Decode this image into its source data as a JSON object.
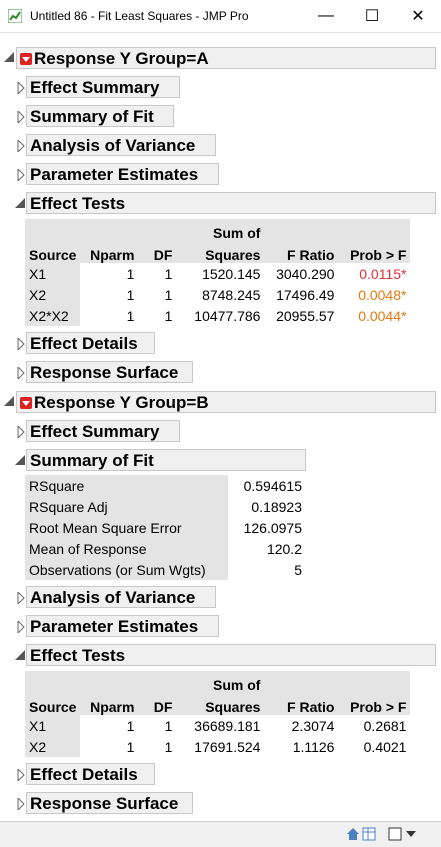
{
  "window": {
    "title": "Untitled 86 - Fit Least Squares - JMP Pro",
    "minimize": "—",
    "maximize": "☐",
    "close": "✕"
  },
  "groupA": {
    "title": "Response Y Group=A",
    "effect_summary": "Effect Summary",
    "summary_of_fit": "Summary of Fit",
    "anova": "Analysis of Variance",
    "param_est": "Parameter Estimates",
    "effect_tests": {
      "title": "Effect Tests",
      "headers": {
        "source": "Source",
        "nparm": "Nparm",
        "df": "DF",
        "ss1": "Sum of",
        "ss2": "Squares",
        "fratio": "F Ratio",
        "prob": "Prob > F"
      },
      "rows": [
        {
          "source": "X1",
          "nparm": "1",
          "df": "1",
          "ss": "1520.145",
          "f": "3040.290",
          "p": "0.0115*",
          "pcolor": "#e0303a"
        },
        {
          "source": "X2",
          "nparm": "1",
          "df": "1",
          "ss": "8748.245",
          "f": "17496.49",
          "p": "0.0048*",
          "pcolor": "#e07a10"
        },
        {
          "source": "X2*X2",
          "nparm": "1",
          "df": "1",
          "ss": "10477.786",
          "f": "20955.57",
          "p": "0.0044*",
          "pcolor": "#e07a10"
        }
      ]
    },
    "effect_details": "Effect Details",
    "response_surface": "Response Surface"
  },
  "groupB": {
    "title": "Response Y Group=B",
    "effect_summary": "Effect Summary",
    "summary_of_fit": {
      "title": "Summary of Fit",
      "rows": [
        {
          "label": "RSquare",
          "value": "0.594615"
        },
        {
          "label": "RSquare Adj",
          "value": "0.18923"
        },
        {
          "label": "Root Mean Square Error",
          "value": "126.0975"
        },
        {
          "label": "Mean of Response",
          "value": "120.2"
        },
        {
          "label": "Observations (or Sum Wgts)",
          "value": "5"
        }
      ]
    },
    "anova": "Analysis of Variance",
    "param_est": "Parameter Estimates",
    "effect_tests": {
      "title": "Effect Tests",
      "headers": {
        "source": "Source",
        "nparm": "Nparm",
        "df": "DF",
        "ss1": "Sum of",
        "ss2": "Squares",
        "fratio": "F Ratio",
        "prob": "Prob > F"
      },
      "rows": [
        {
          "source": "X1",
          "nparm": "1",
          "df": "1",
          "ss": "36689.181",
          "f": "2.3074",
          "p": "0.2681"
        },
        {
          "source": "X2",
          "nparm": "1",
          "df": "1",
          "ss": "17691.524",
          "f": "1.1126",
          "p": "0.4021"
        }
      ]
    },
    "effect_details": "Effect Details",
    "response_surface": "Response Surface"
  }
}
